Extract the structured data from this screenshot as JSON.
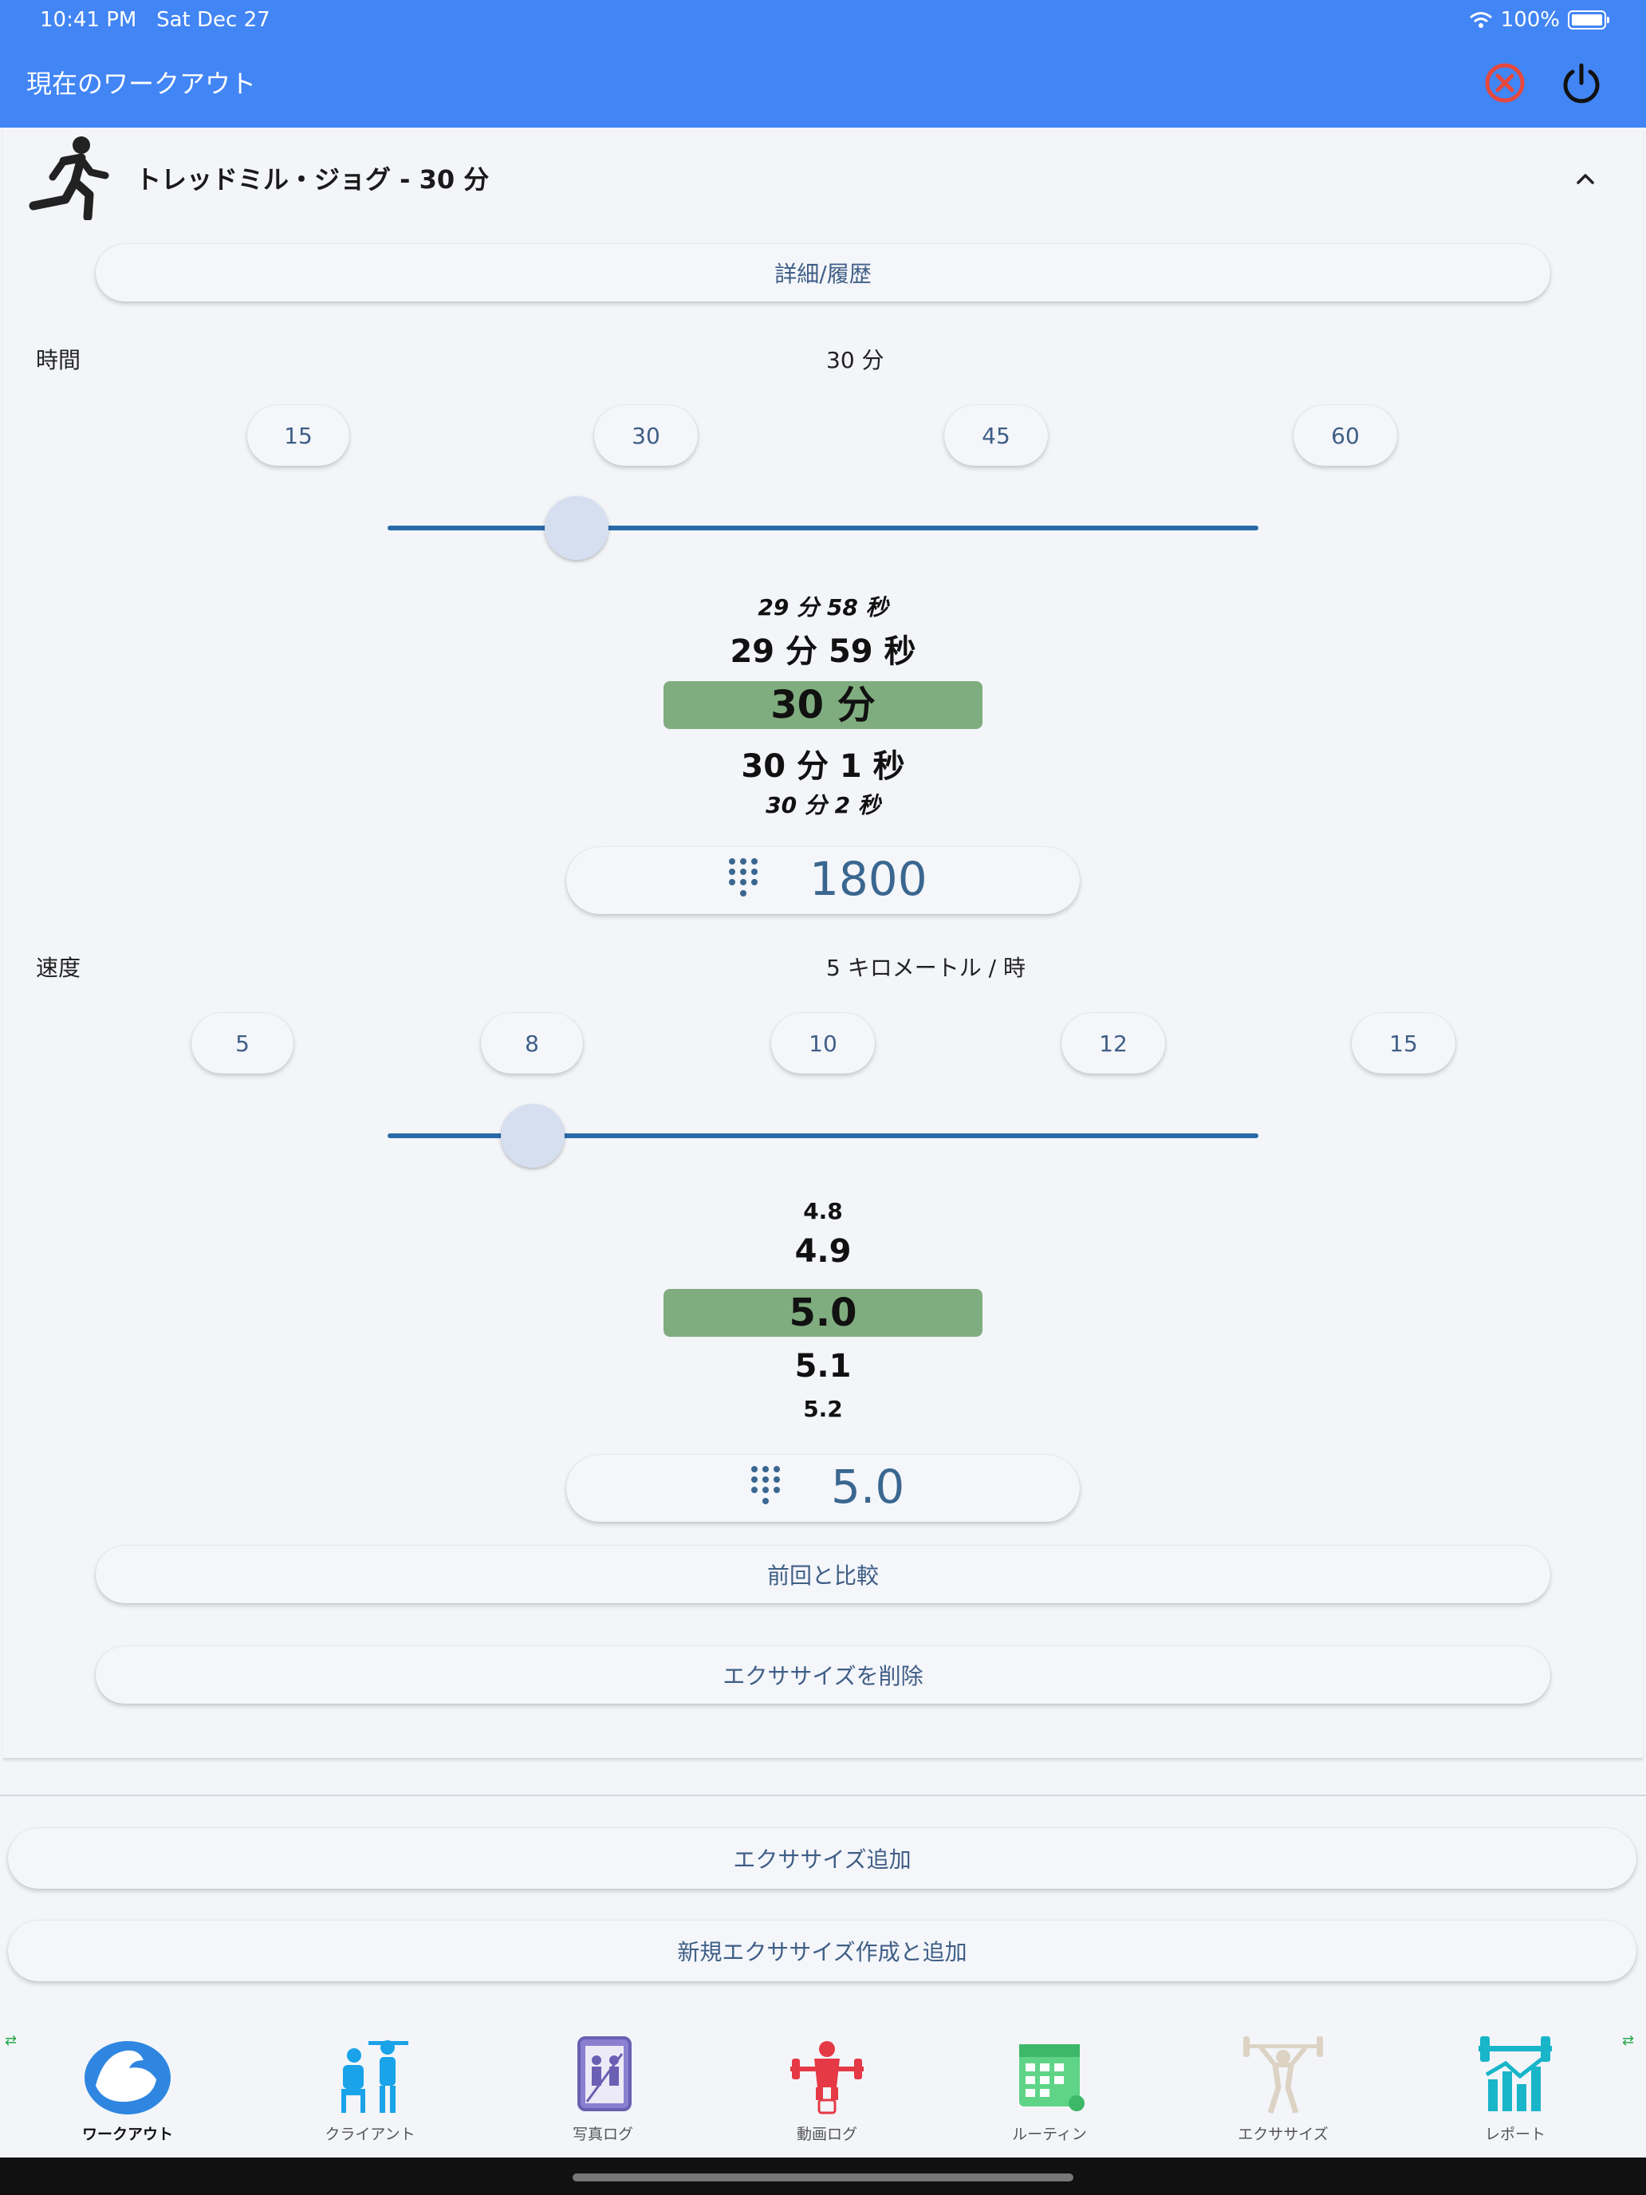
{
  "status_bar": {
    "time": "10:41 PM",
    "date": "Sat Dec 27",
    "battery": "100%"
  },
  "app_bar": {
    "title": "現在のワークアウト",
    "icons": [
      "cancel-icon",
      "power-icon"
    ],
    "cancel_color": "#e5483c"
  },
  "exercise": {
    "title": "トレッドミル・ジョグ - 30 分",
    "icon": "running-person-icon",
    "details_button": "詳細/履歴",
    "time": {
      "label": "時間",
      "current": "30 分",
      "presets": [
        "15",
        "30",
        "45",
        "60"
      ],
      "slider_value": 30,
      "slider_range": [
        5,
        120
      ],
      "wheel": [
        "29 分 58 秒",
        "29 分 59 秒",
        "30 分",
        "30 分 1 秒",
        "30 分 2 秒"
      ],
      "numeric_value": "1800"
    },
    "speed": {
      "label": "速度",
      "current": "5 キロメートル / 時",
      "presets": [
        "5",
        "8",
        "10",
        "12",
        "15"
      ],
      "slider_value": 5,
      "slider_range": [
        1,
        25
      ],
      "wheel": [
        "4.8",
        "4.9",
        "5.0",
        "5.1",
        "5.2"
      ],
      "numeric_value": "5.0"
    },
    "compare_button": "前回と比較",
    "delete_button": "エクササイズを削除"
  },
  "actions": {
    "add_exercise": "エクササイズ追加",
    "create_and_add": "新規エクササイズ作成と追加"
  },
  "bottom_nav": [
    {
      "label": "ワークアウト",
      "icon": "flexed-bicep-icon",
      "active": true
    },
    {
      "label": "クライアント",
      "icon": "trainer-client-icon",
      "active": false
    },
    {
      "label": "写真ログ",
      "icon": "photo-log-icon",
      "active": false
    },
    {
      "label": "動画ログ",
      "icon": "weightlifter-video-icon",
      "active": false
    },
    {
      "label": "ルーティン",
      "icon": "calendar-icon",
      "active": false
    },
    {
      "label": "エクササイズ",
      "icon": "barbell-person-icon",
      "active": false
    },
    {
      "label": "レポート",
      "icon": "report-chart-icon",
      "active": false
    }
  ],
  "colors": {
    "primary": "#4285f4",
    "wheel_highlight": "#80ad7f",
    "slider": "#2a6aa8",
    "button_text": "#3f5e86"
  }
}
